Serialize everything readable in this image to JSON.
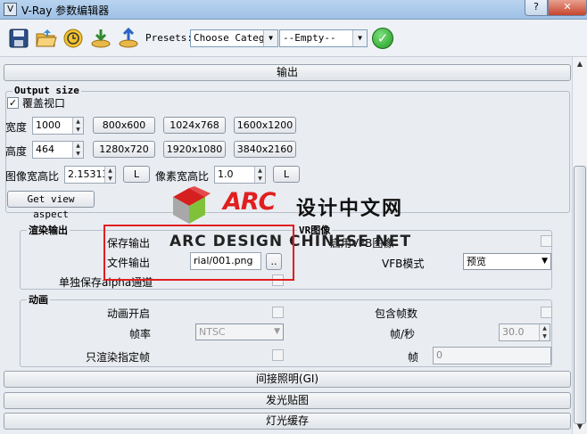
{
  "window": {
    "title": "V-Ray 参数编辑器",
    "help": "?",
    "close": "✕"
  },
  "toolbar": {
    "icons": [
      "save-icon",
      "open-icon",
      "revert-icon",
      "import-icon",
      "export-icon"
    ],
    "presets_label": "Presets:",
    "category": "Choose Catego",
    "preset_value": "--Empty--",
    "apply": "✓"
  },
  "rollouts": {
    "output": "输出",
    "gi": "间接照明(GI)",
    "caustics": "发光贴图",
    "light_cache": "灯光缓存"
  },
  "output_size": {
    "title": "Output size",
    "override_viewport": "覆盖视口",
    "override_checked": "✓",
    "width_label": "宽度",
    "width_value": "1000",
    "height_label": "高度",
    "height_value": "464",
    "presets_row1": [
      "800x600",
      "1024x768",
      "1600x1200"
    ],
    "presets_row2": [
      "1280x720",
      "1920x1080",
      "3840x2160"
    ],
    "image_aspect_label": "图像宽高比",
    "image_aspect_value": "2.15313",
    "pixel_aspect_label": "像素宽高比",
    "pixel_aspect_value": "1.0",
    "lock": "L",
    "get_view_aspect": "Get view aspect"
  },
  "render_output": {
    "title": "渲染输出",
    "save_output": "保存输出",
    "file_output": "文件输出",
    "file_path": "rial/001.png",
    "browse": "..",
    "separate_alpha": "单独保存alpha通道",
    "vfb_title": "VR图像",
    "vfb_label": "启用VFB图像",
    "vfb_mode_label": "VFB模式",
    "vfb_mode_value": "预览"
  },
  "animation": {
    "title": "动画",
    "enable": "动画开启",
    "include_frames": "包含帧数",
    "frame_rate_label": "帧率",
    "frame_rate_value": "NTSC",
    "fps_label": "帧/秒",
    "fps_value": "30.0",
    "render_specified": "只渲染指定帧",
    "frame_label": "帧",
    "frame_value": "0"
  },
  "watermark": {
    "brand": "ARC",
    "cn": "设计中文网",
    "en": "ARC DESIGN CHINESE NET"
  }
}
